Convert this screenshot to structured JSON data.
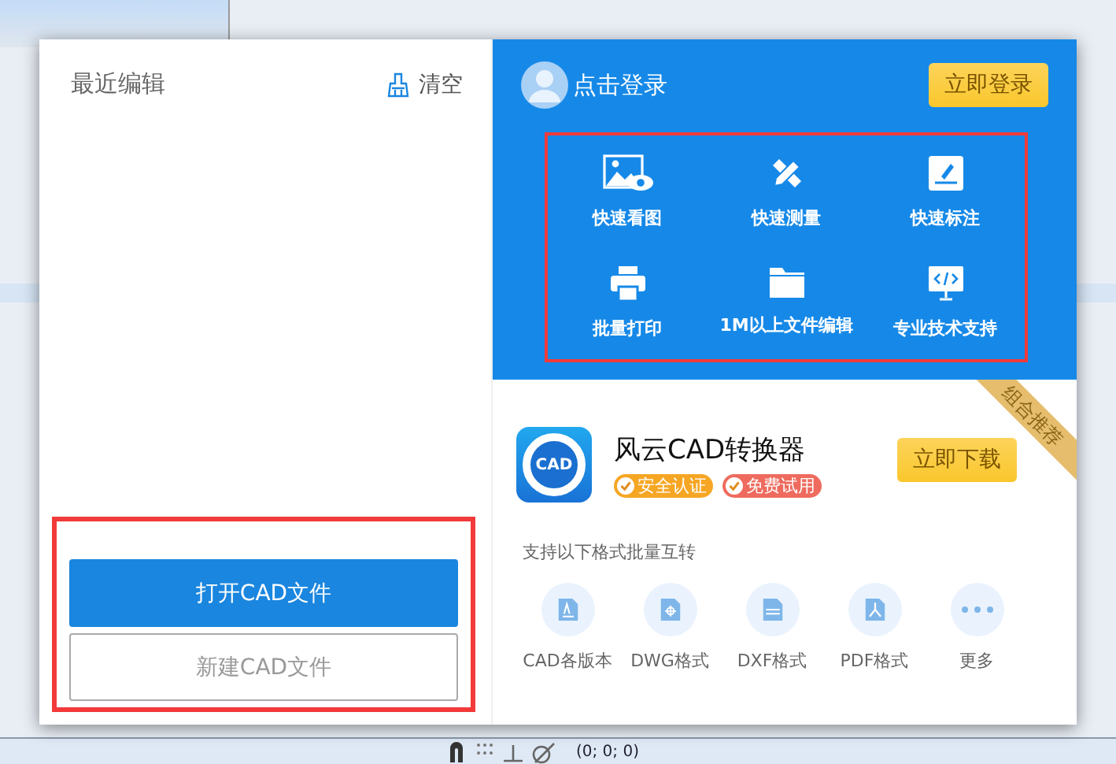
{
  "recent": {
    "title": "最近编辑",
    "clear": "清空"
  },
  "actions": [
    {
      "label": "打开CAD文件",
      "kind": "primary"
    },
    {
      "label": "新建CAD文件",
      "kind": "secondary"
    }
  ],
  "login": {
    "prompt": "点击登录",
    "button": "立即登录"
  },
  "features": [
    {
      "label": "快速看图",
      "kind": "view"
    },
    {
      "label": "快速测量",
      "kind": "measure"
    },
    {
      "label": "快速标注",
      "kind": "annotate"
    },
    {
      "label": "批量打印",
      "kind": "print"
    },
    {
      "label": "1M以上文件编辑",
      "kind": "folder"
    },
    {
      "label": "专业技术支持",
      "kind": "code"
    }
  ],
  "promo": {
    "ribbon": "组合推荐",
    "name": "风云CAD转换器",
    "logo_text": "CAD",
    "badges": [
      {
        "label": "安全认证",
        "color": "#f6a623"
      },
      {
        "label": "免费试用",
        "color": "#ee6b5e"
      }
    ],
    "button": "立即下载",
    "subtitle": "支持以下格式批量互转",
    "formats": [
      {
        "label": "CAD各版本",
        "kind": "cad"
      },
      {
        "label": "DWG格式",
        "kind": "dwg"
      },
      {
        "label": "DXF格式",
        "kind": "dxf"
      },
      {
        "label": "PDF格式",
        "kind": "pdf"
      },
      {
        "label": "更多",
        "kind": "more"
      }
    ]
  },
  "status_bar": {
    "coords": "(0; 0; 0)"
  }
}
